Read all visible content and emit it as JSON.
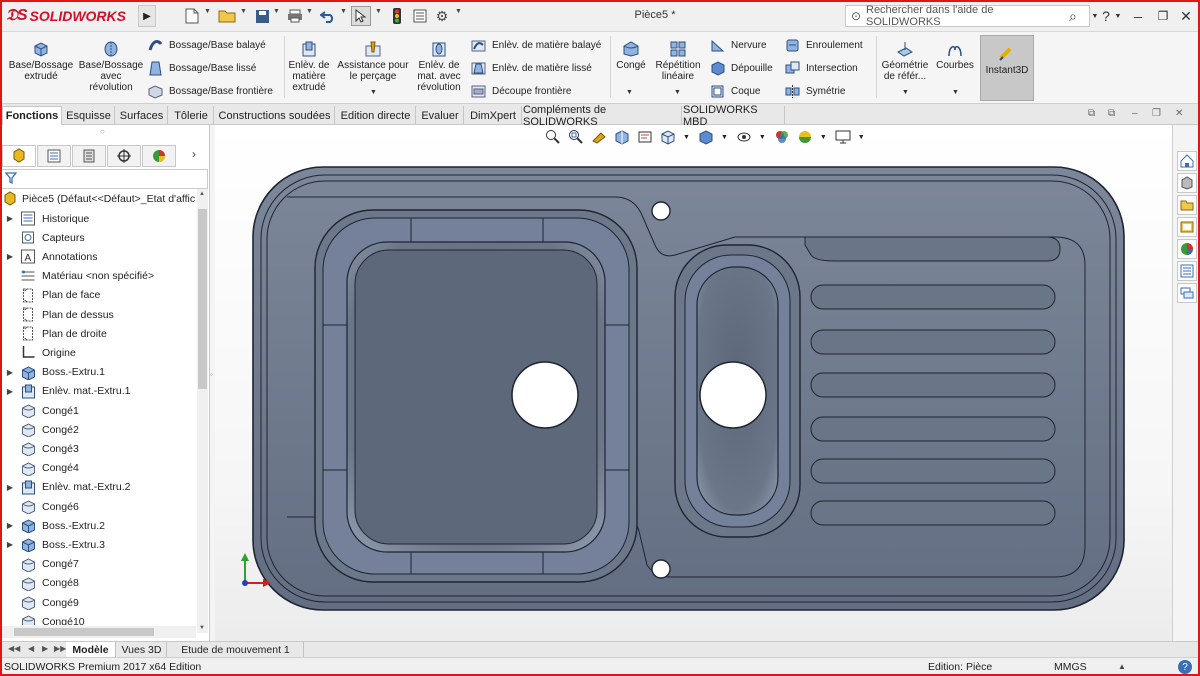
{
  "app": {
    "logo_text": "SOLIDWORKS",
    "doc_title": "Pièce5 *",
    "help_search_placeholder": "Rechercher dans l'aide de SOLIDWORKS"
  },
  "ribbon": {
    "base_extrude": [
      "Base/Bossage",
      "extrudé"
    ],
    "base_revolve": [
      "Base/Bossage",
      "avec",
      "révolution"
    ],
    "boss_sweep": "Bossage/Base balayé",
    "boss_loft": "Bossage/Base lissé",
    "boss_boundary": "Bossage/Base frontière",
    "cut_extrude": [
      "Enlèv. de",
      "matière",
      "extrudé"
    ],
    "hole_wizard": [
      "Assistance pour",
      "le perçage"
    ],
    "cut_revolve": [
      "Enlèv. de",
      "mat. avec",
      "révolution"
    ],
    "cut_sweep": "Enlèv. de matière balayé",
    "cut_loft": "Enlèv. de matière lissé",
    "cut_boundary": "Découpe frontière",
    "fillet": "Congé",
    "linear_pattern": [
      "Répétition",
      "linéaire"
    ],
    "rib": "Nervure",
    "draft": "Dépouille",
    "shell": "Coque",
    "wrap": "Enroulement",
    "intersect": "Intersection",
    "mirror": "Symétrie",
    "ref_geometry": [
      "Géométrie",
      "de référ..."
    ],
    "curves": "Courbes",
    "instant3d": "Instant3D"
  },
  "tabs": [
    "Fonctions",
    "Esquisse",
    "Surfaces",
    "Tôlerie",
    "Constructions soudées",
    "Edition directe",
    "Evaluer",
    "DimXpert",
    "Compléments de SOLIDWORKS",
    "SOLIDWORKS MBD"
  ],
  "tree": {
    "root": "Pièce5  (Défaut<<Défaut>_Etat d'affic",
    "items": [
      {
        "label": "Historique",
        "icon": "history-icon",
        "expand": true
      },
      {
        "label": "Capteurs",
        "icon": "sensors-icon",
        "expand": false
      },
      {
        "label": "Annotations",
        "icon": "annotations-icon",
        "expand": true
      },
      {
        "label": "Matériau <non spécifié>",
        "icon": "material-icon",
        "expand": false
      },
      {
        "label": "Plan de face",
        "icon": "plane-icon",
        "expand": false
      },
      {
        "label": "Plan de dessus",
        "icon": "plane-icon",
        "expand": false
      },
      {
        "label": "Plan de droite",
        "icon": "plane-icon",
        "expand": false
      },
      {
        "label": "Origine",
        "icon": "origin-icon",
        "expand": false
      },
      {
        "label": "Boss.-Extru.1",
        "icon": "boss-extrude-icon",
        "expand": true
      },
      {
        "label": "Enlèv. mat.-Extru.1",
        "icon": "cut-extrude-icon",
        "expand": true
      },
      {
        "label": "Congé1",
        "icon": "fillet-icon",
        "expand": false
      },
      {
        "label": "Congé2",
        "icon": "fillet-icon",
        "expand": false
      },
      {
        "label": "Congé3",
        "icon": "fillet-icon",
        "expand": false
      },
      {
        "label": "Congé4",
        "icon": "fillet-icon",
        "expand": false
      },
      {
        "label": "Enlèv. mat.-Extru.2",
        "icon": "cut-extrude-icon",
        "expand": true
      },
      {
        "label": "Congé6",
        "icon": "fillet-icon",
        "expand": false
      },
      {
        "label": "Boss.-Extru.2",
        "icon": "boss-extrude-icon",
        "expand": true
      },
      {
        "label": "Boss.-Extru.3",
        "icon": "boss-extrude-icon",
        "expand": true
      },
      {
        "label": "Congé7",
        "icon": "fillet-icon",
        "expand": false
      },
      {
        "label": "Congé8",
        "icon": "fillet-icon",
        "expand": false
      },
      {
        "label": "Congé9",
        "icon": "fillet-icon",
        "expand": false
      },
      {
        "label": "Congé10",
        "icon": "fillet-icon",
        "expand": false
      }
    ]
  },
  "bottom_tabs": [
    "Modèle",
    "Vues 3D",
    "Etude de mouvement 1"
  ],
  "status": {
    "product": "SOLIDWORKS Premium 2017 x64 Edition",
    "mode": "Edition: Pièce",
    "units": "MMGS"
  },
  "colors": {
    "brand_red": "#d0102a",
    "model_fill": "#6f7a8c",
    "model_edge": "#1e2533"
  }
}
